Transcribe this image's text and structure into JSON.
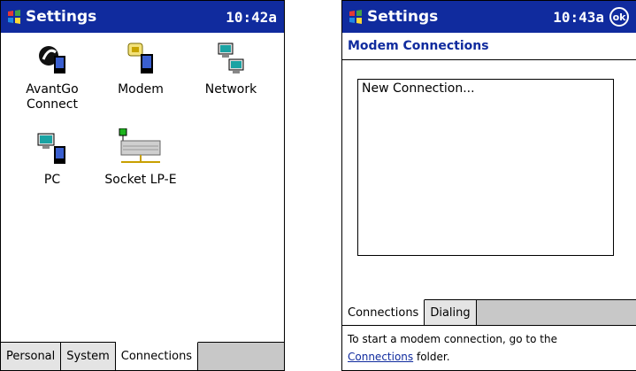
{
  "left_screen": {
    "title": "Settings",
    "clock": "10:42a",
    "apps": [
      {
        "label": "AvantGo Connect",
        "icon": "avantgo-icon"
      },
      {
        "label": "Modem",
        "icon": "modem-icon"
      },
      {
        "label": "Network",
        "icon": "network-icon"
      },
      {
        "label": "PC",
        "icon": "pc-icon"
      },
      {
        "label": "Socket LP-E",
        "icon": "socket-card-icon"
      }
    ],
    "tabs": [
      "Personal",
      "System",
      "Connections"
    ],
    "active_tab": "Connections"
  },
  "right_screen": {
    "title": "Settings",
    "clock": "10:43a",
    "ok_label": "ok",
    "header": "Modem Connections",
    "list_items": [
      "New Connection..."
    ],
    "tabs": [
      "Connections",
      "Dialing"
    ],
    "active_tab": "Connections",
    "hint_text": "To start a modem connection, go to the",
    "hint_link": "Connections",
    "hint_suffix": " folder."
  },
  "colors": {
    "titlebar": "#102b9e",
    "link": "#102b9e"
  }
}
